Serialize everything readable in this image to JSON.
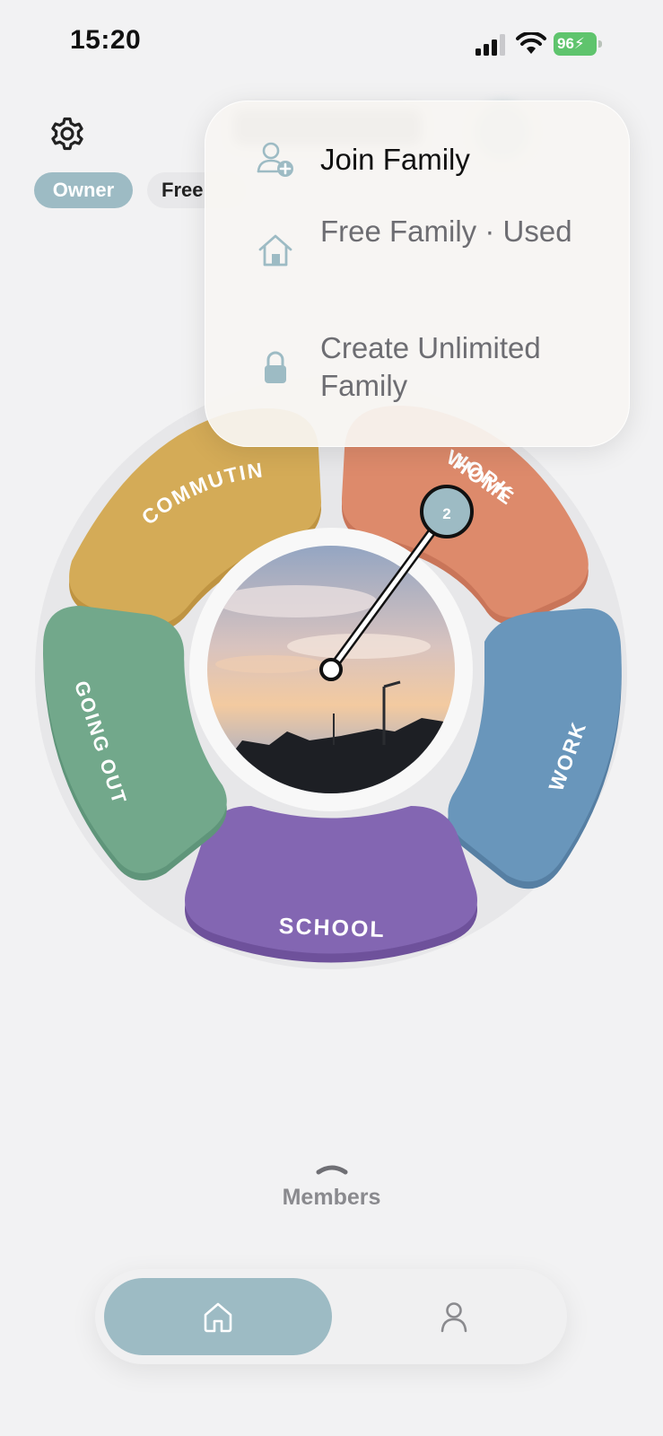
{
  "status_bar": {
    "time": "15:20",
    "battery": "96"
  },
  "header": {
    "role_badge": "Owner",
    "plan_chip": "Free"
  },
  "wheel": {
    "segments": [
      {
        "id": "commuting",
        "label": "COMMUTING",
        "color": "#d4ab57"
      },
      {
        "id": "home",
        "label": "HOME",
        "color": "#dd8a6b"
      },
      {
        "id": "work",
        "label": "WORK",
        "color": "#6996bb"
      },
      {
        "id": "school",
        "label": "SCHOOL",
        "color": "#8366b2"
      },
      {
        "id": "going_out",
        "label": "GOING OUT",
        "color": "#72a88b"
      }
    ],
    "pointer_count": "2"
  },
  "menu": {
    "items": [
      {
        "label": "Join Family",
        "icon": "add-user-icon"
      },
      {
        "label": "Free Family · Used",
        "icon": "house-icon"
      },
      {
        "label": "Create Unlimited Family",
        "icon": "lock-icon"
      }
    ]
  },
  "members": {
    "label": "Members"
  },
  "tabbar": {
    "tabs": [
      {
        "icon": "home-icon"
      },
      {
        "icon": "profile-icon"
      }
    ]
  },
  "colors": {
    "accent": "#9dbbc4",
    "background": "#f2f2f3"
  }
}
